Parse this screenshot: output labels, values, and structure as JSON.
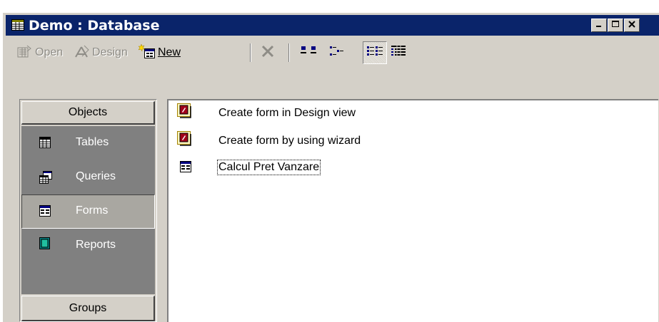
{
  "window": {
    "title": "Demo : Database",
    "controls": [
      "minimize",
      "maximize",
      "close"
    ]
  },
  "toolbar": {
    "open_label": "Open",
    "design_label": "Design",
    "new_label": "New",
    "delete_icon": "delete-x-icon",
    "view_modes": [
      "large-icons",
      "small-icons",
      "list",
      "details"
    ],
    "active_view": "list"
  },
  "sidebar": {
    "objects_label": "Objects",
    "groups_label": "Groups",
    "items": [
      {
        "label": "Tables",
        "icon": "table-icon"
      },
      {
        "label": "Queries",
        "icon": "query-icon"
      },
      {
        "label": "Forms",
        "icon": "form-icon",
        "selected": true
      },
      {
        "label": "Reports",
        "icon": "report-icon"
      }
    ]
  },
  "list": {
    "items": [
      {
        "label": "Create form in Design view",
        "icon": "design-view-shortcut-icon"
      },
      {
        "label": "Create form by using wizard",
        "icon": "wizard-shortcut-icon"
      },
      {
        "label": "Calcul Pret Vanzare",
        "icon": "form-icon",
        "focused": true
      }
    ]
  },
  "colors": {
    "titlebar": "#0a246a",
    "face": "#d4d0c8",
    "sidebar_bg": "#808080"
  }
}
